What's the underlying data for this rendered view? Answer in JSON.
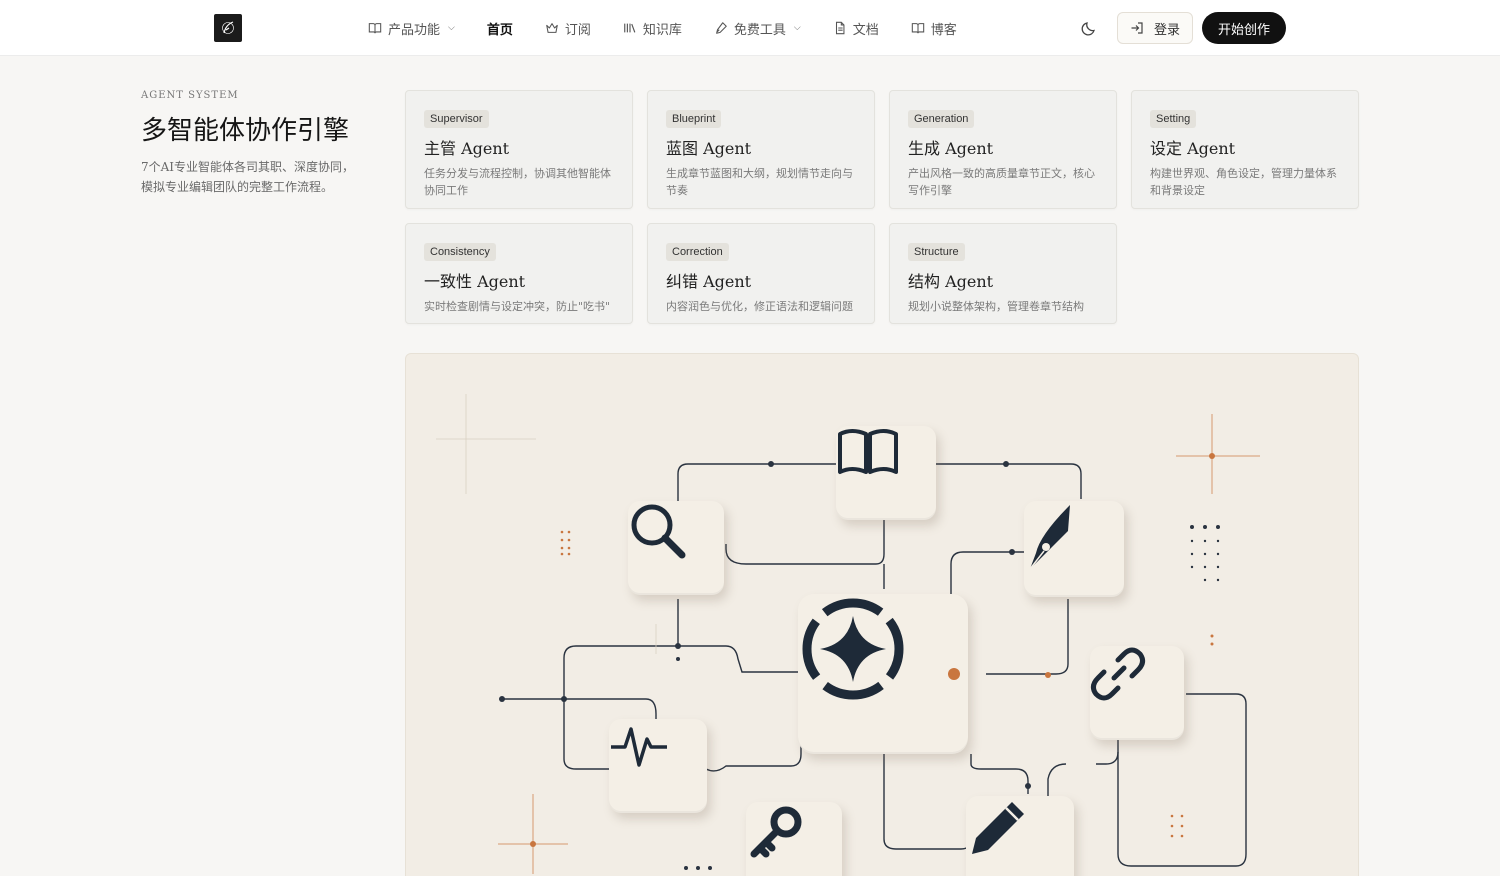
{
  "header": {
    "nav": [
      {
        "label": "产品功能",
        "icon": "book-open-icon",
        "dropdown": true
      },
      {
        "label": "首页",
        "icon": "",
        "dropdown": false,
        "active": true
      },
      {
        "label": "订阅",
        "icon": "crown-icon",
        "dropdown": false
      },
      {
        "label": "知识库",
        "icon": "library-icon",
        "dropdown": false
      },
      {
        "label": "免费工具",
        "icon": "pen-tool-icon",
        "dropdown": true
      },
      {
        "label": "文档",
        "icon": "file-text-icon",
        "dropdown": false
      },
      {
        "label": "博客",
        "icon": "book-open-icon",
        "dropdown": false
      }
    ],
    "login_label": "登录",
    "start_label": "开始创作"
  },
  "intro": {
    "eyebrow": "AGENT SYSTEM",
    "title": "多智能体协作引擎",
    "description": "7个AI专业智能体各司其职、深度协同，模拟专业编辑团队的完整工作流程。"
  },
  "agents": [
    {
      "tag": "Supervisor",
      "name": "主管 Agent",
      "desc": "任务分发与流程控制，协调其他智能体协同工作"
    },
    {
      "tag": "Blueprint",
      "name": "蓝图 Agent",
      "desc": "生成章节蓝图和大纲，规划情节走向与节奏"
    },
    {
      "tag": "Generation",
      "name": "生成 Agent",
      "desc": "产出风格一致的高质量章节正文，核心写作引擎"
    },
    {
      "tag": "Setting",
      "name": "设定 Agent",
      "desc": "构建世界观、角色设定，管理力量体系和背景设定"
    },
    {
      "tag": "Consistency",
      "name": "一致性 Agent",
      "desc": "实时检查剧情与设定冲突，防止\"吃书\""
    },
    {
      "tag": "Correction",
      "name": "纠错 Agent",
      "desc": "内容润色与优化，修正语法和逻辑问题"
    },
    {
      "tag": "Structure",
      "name": "结构 Agent",
      "desc": "规划小说整体架构，管理卷章节结构"
    }
  ],
  "colors": {
    "accent": "#c9763f",
    "ink": "#1e2a38",
    "illus_bg": "#f2ede5",
    "card_bg": "#f1f1ef"
  },
  "illustration_icons": [
    "book-icon",
    "search-icon",
    "fountain-pen-icon",
    "compass-star-icon",
    "link-icon",
    "pulse-icon",
    "key-icon",
    "pencil-icon"
  ]
}
